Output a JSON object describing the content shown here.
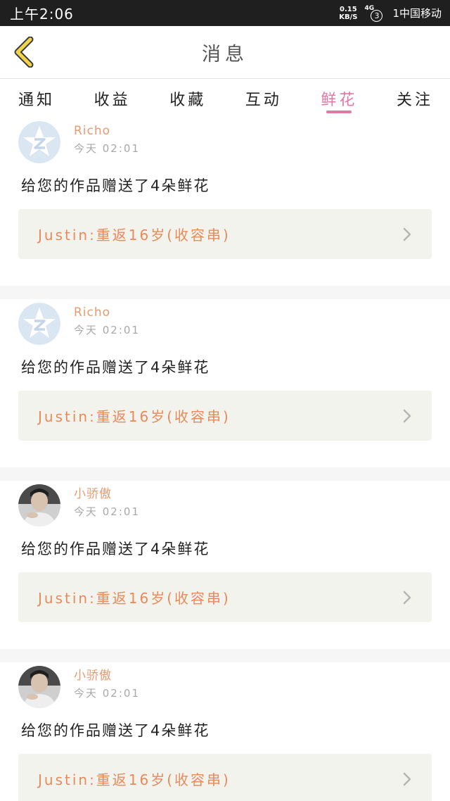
{
  "status_bar": {
    "time": "上午2:06",
    "net_speed_value": "0.15",
    "net_speed_unit": "KB/S",
    "signal_type": "4G",
    "signal_count": "3",
    "carrier": "1中国移动"
  },
  "header": {
    "title": "消息",
    "back_icon": "chevron-left-icon"
  },
  "tabs": [
    {
      "label": "通知",
      "active": false
    },
    {
      "label": "收益",
      "active": false
    },
    {
      "label": "收藏",
      "active": false
    },
    {
      "label": "互动",
      "active": false
    },
    {
      "label": "鲜花",
      "active": true
    },
    {
      "label": "关注",
      "active": false
    }
  ],
  "notifications": [
    {
      "user": "Richo",
      "avatar": "default-avatar",
      "time": "今天 02:01",
      "message": "给您的作品赠送了4朵鲜花",
      "work": "Justin:重返16岁(收容串)"
    },
    {
      "user": "Richo",
      "avatar": "default-avatar",
      "time": "今天 02:01",
      "message": "给您的作品赠送了4朵鲜花",
      "work": "Justin:重返16岁(收容串)"
    },
    {
      "user": "小骄傲",
      "avatar": "photo-avatar",
      "time": "今天 02:01",
      "message": "给您的作品赠送了4朵鲜花",
      "work": "Justin:重返16岁(收容串)"
    },
    {
      "user": "小骄傲",
      "avatar": "photo-avatar",
      "time": "今天 02:01",
      "message": "给您的作品赠送了4朵鲜花",
      "work": "Justin:重返16岁(收容串)"
    }
  ],
  "colors": {
    "accent_pink": "#e377a6",
    "username_orange": "#e49b71",
    "work_title_orange": "#e88a5a",
    "back_arrow_yellow": "#f2d44c",
    "link_box_bg": "#f3f3ed"
  }
}
